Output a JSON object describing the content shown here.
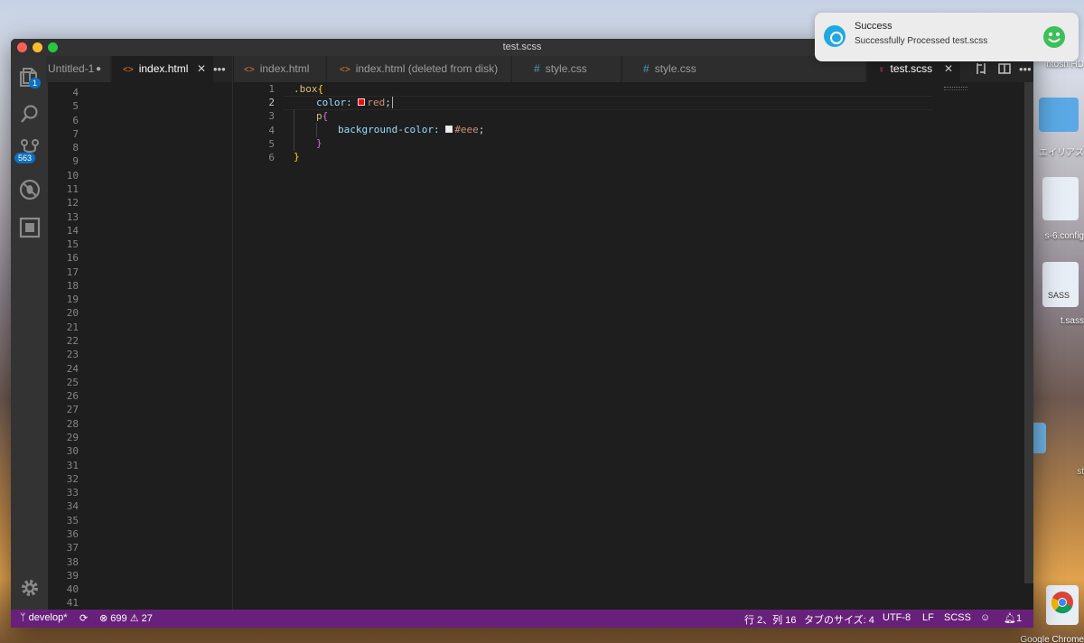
{
  "window": {
    "title": "test.scss"
  },
  "notification": {
    "title": "Success",
    "message": "Successfully Processed test.scss"
  },
  "desktop": {
    "labels": [
      "ntosh HD",
      "エイリアス",
      "s-6.config",
      "SASS",
      "t.sass",
      "st",
      "Google Chrome"
    ]
  },
  "activity_bar": {
    "explorer_badge": "1",
    "scm_badge": "563"
  },
  "group1": {
    "tabs": [
      {
        "label": "Untitled-1",
        "dirty": true
      },
      {
        "label": "index.html",
        "active": true
      }
    ],
    "more": "•••",
    "line_numbers": [
      "4",
      "5",
      "6",
      "7",
      "8",
      "9",
      "10",
      "11",
      "12",
      "13",
      "14",
      "15",
      "16",
      "17",
      "18",
      "19",
      "20",
      "21",
      "22",
      "23",
      "24",
      "25",
      "26",
      "27",
      "28",
      "29",
      "30",
      "31",
      "32",
      "33",
      "34",
      "35",
      "36",
      "37",
      "38",
      "39",
      "40",
      "41"
    ]
  },
  "group2": {
    "tabs": [
      {
        "label": "index.html",
        "icon": "html"
      },
      {
        "label": "index.html (deleted from disk)",
        "icon": "html"
      },
      {
        "label": "style.css",
        "icon": "css"
      },
      {
        "label": "style.css",
        "icon": "css"
      },
      {
        "label": "test.scss",
        "icon": "scss",
        "active": true
      }
    ],
    "more": "•••",
    "line_numbers": [
      "1",
      "2",
      "3",
      "4",
      "5",
      "6"
    ],
    "code": {
      "l1_sel": ".box",
      "l1_brace": "{",
      "l2_prop": "color: ",
      "l2_val": "red",
      "l2_semi": ";",
      "l3_sel": "p",
      "l3_brace": "{",
      "l4_prop": "background-color: ",
      "l4_val": "#eee",
      "l4_semi": ";",
      "l5_brace": "}",
      "l6_brace": "}"
    }
  },
  "statusbar": {
    "branch": "develop*",
    "errors": "699",
    "warnings": "27",
    "position": "行 2、列 16",
    "tabsize": "タブのサイズ: 4",
    "encoding": "UTF-8",
    "eol": "LF",
    "language": "SCSS",
    "notifications": "1"
  },
  "colors": {
    "statusbar": "#68217a",
    "red_swatch": "#ff0000",
    "eee_swatch": "#eeeeee"
  }
}
